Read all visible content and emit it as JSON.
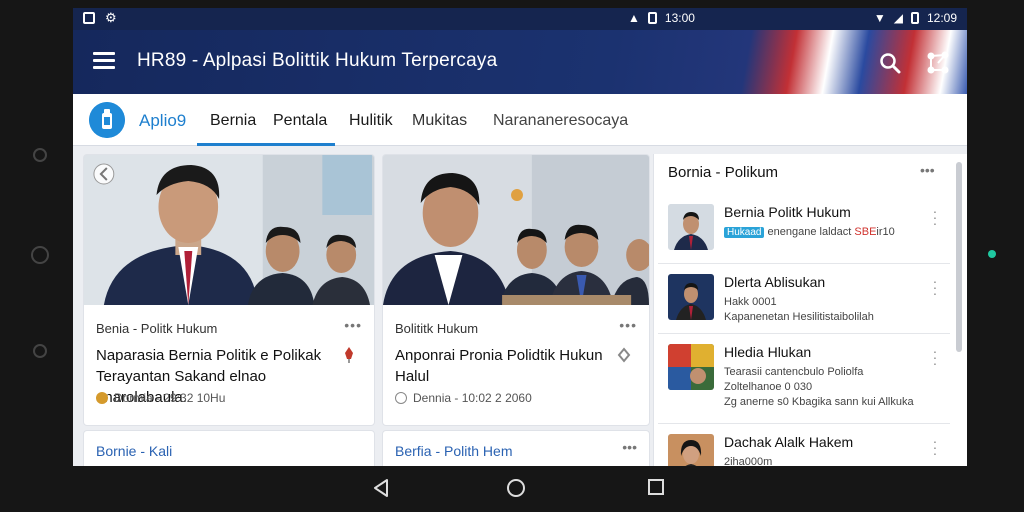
{
  "status_bar": {
    "left_icons": [
      "image-icon",
      "settings-icon"
    ],
    "mid_time": "13:00",
    "right_time": "12:09"
  },
  "app_bar": {
    "title": "HR89 - Aplpasi Bolittik Hukum Terpercaya",
    "icons": [
      "menu-icon",
      "search-icon",
      "share-icon"
    ]
  },
  "tab_bar": {
    "logo_text": "Aplio9",
    "tabs": [
      "Bernia",
      "Pentala",
      "Hulitik",
      "Mukitas",
      "Narananeresocaya"
    ],
    "active_tab": "Bernia"
  },
  "cards": [
    {
      "category": "Benia - Politk Hukum",
      "more": "•••",
      "headline": "Naparasia Bernia Politik e Polikak Terayantan Sakand elnao anarolabaula.",
      "meta": "Dormia - 29:32 10Hu"
    },
    {
      "category": "Bolititk Hukum",
      "more": "•••",
      "headline": "Anponrai Pronia Polidtik Hukun Halul",
      "meta": "Dennia - 10:02 2 2060"
    }
  ],
  "cards_row2": [
    {
      "title": "Bornie - Kali",
      "more": ""
    },
    {
      "title": "Berfia - Polith Hem",
      "more": "•••"
    }
  ],
  "side_panel": {
    "title": "Bornia - Polikum",
    "more": "•••",
    "items": [
      {
        "title": "Bernia Politk Hukum",
        "badge": "Hukaad",
        "sub1_rest": " enengane laldact ",
        "sub1_red": "SBE",
        "sub1_end": "ir10",
        "sub2": "",
        "sub3": ""
      },
      {
        "title": "Dlerta Ablisukan",
        "badge": "",
        "sub1_rest": "Hakk 0001",
        "sub1_red": "",
        "sub1_end": "",
        "sub2": "Kapanenetan Hesilitistaibolilah",
        "sub3": ""
      },
      {
        "title": "Hledia Hlukan",
        "badge": "",
        "sub1_rest": "Tearasii cantencbulo Poliolfa",
        "sub1_red": "",
        "sub1_end": "",
        "sub2": "Zoltelhanoe 0 030",
        "sub3": "Zg anerne s0 Kbagika sann kui Allkuka"
      },
      {
        "title": "Dachak Alalk Hakem",
        "badge": "",
        "sub1_rest": "2iha000m",
        "sub1_red": "",
        "sub1_end": "",
        "sub2": "",
        "sub3": ""
      }
    ]
  },
  "nav_bar": [
    "back-icon",
    "home-icon",
    "recents-icon"
  ],
  "colors": {
    "app_bar": "#15285c",
    "accent": "#1e7fce",
    "screen_bg": "#eceef2"
  }
}
